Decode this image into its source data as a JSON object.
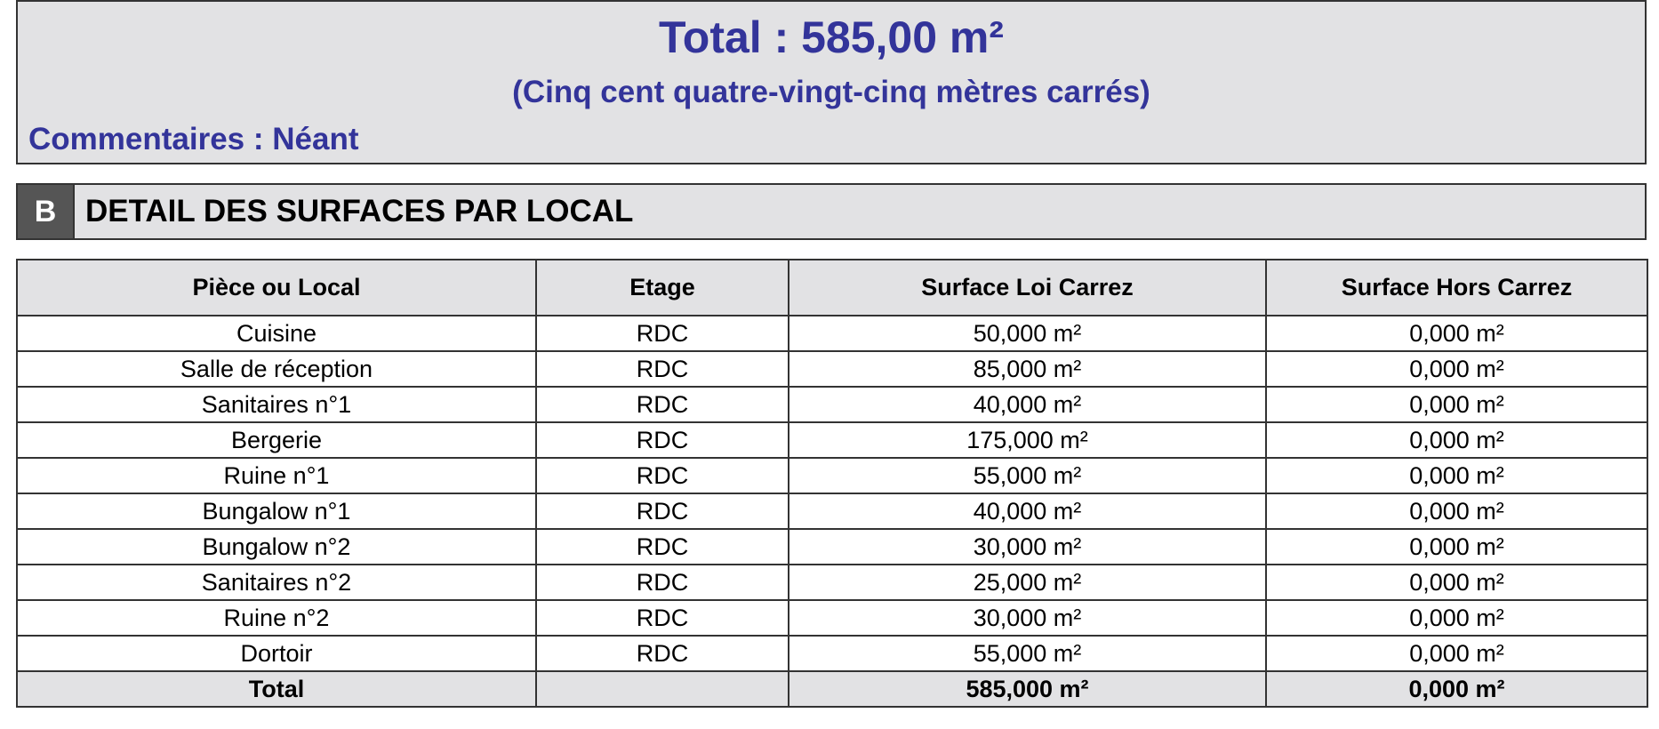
{
  "summary": {
    "total": "Total : 585,00 m²",
    "total_words": "(Cinq cent quatre-vingt-cinq mètres carrés)",
    "comments": "Commentaires : Néant"
  },
  "section": {
    "letter": "B",
    "title": "DETAIL DES SURFACES PAR LOCAL"
  },
  "table": {
    "headers": [
      "Pièce ou Local",
      "Etage",
      "Surface Loi Carrez",
      "Surface Hors Carrez"
    ],
    "rows": [
      [
        "Cuisine",
        "RDC",
        "50,000 m²",
        "0,000 m²"
      ],
      [
        "Salle de réception",
        "RDC",
        "85,000 m²",
        "0,000 m²"
      ],
      [
        "Sanitaires n°1",
        "RDC",
        "40,000 m²",
        "0,000 m²"
      ],
      [
        "Bergerie",
        "RDC",
        "175,000 m²",
        "0,000 m²"
      ],
      [
        "Ruine n°1",
        "RDC",
        "55,000 m²",
        "0,000 m²"
      ],
      [
        "Bungalow n°1",
        "RDC",
        "40,000 m²",
        "0,000 m²"
      ],
      [
        "Bungalow n°2",
        "RDC",
        "30,000 m²",
        "0,000 m²"
      ],
      [
        "Sanitaires n°2",
        "RDC",
        "25,000 m²",
        "0,000 m²"
      ],
      [
        "Ruine n°2",
        "RDC",
        "30,000 m²",
        "0,000 m²"
      ],
      [
        "Dortoir",
        "RDC",
        "55,000 m²",
        "0,000 m²"
      ]
    ],
    "total_row": [
      "Total",
      "",
      "585,000 m²",
      "0,000 m²"
    ]
  }
}
